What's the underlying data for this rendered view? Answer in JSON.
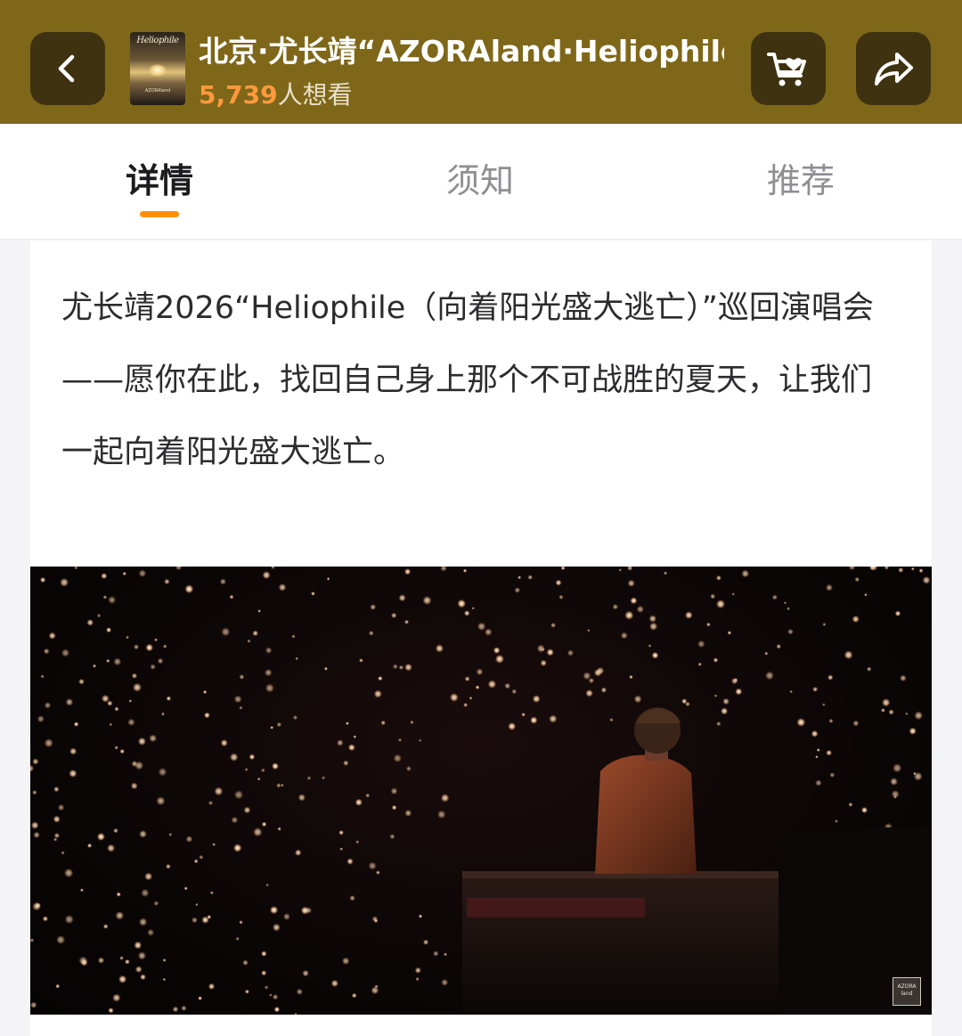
{
  "header": {
    "title": "北京·尤长靖“AZORAland·Heliophile…",
    "want_count": "5,739",
    "want_label": "人想看",
    "poster_logo": "Heliophile",
    "poster_small": "AZORAland",
    "colors": {
      "bar": "#7f6719",
      "button": "#3e3210",
      "count": "#ff9a3c"
    },
    "icons": {
      "back": "chevron-left-icon",
      "cart": "cart-heart-icon",
      "share": "share-arrow-icon"
    }
  },
  "tabs": [
    {
      "label": "详情",
      "active": true
    },
    {
      "label": "须知",
      "active": false
    },
    {
      "label": "推荐",
      "active": false
    }
  ],
  "tab_indicator_color": "#ff9000",
  "content": {
    "description": "尤长靖2026“Heliophile（向着阳光盛大逃亡）”巡回演唱会——愿你在此，找回自己身上那个不可战胜的夏天，让我们一起向着阳光盛大逃亡。",
    "watermark": "AZORA land"
  }
}
